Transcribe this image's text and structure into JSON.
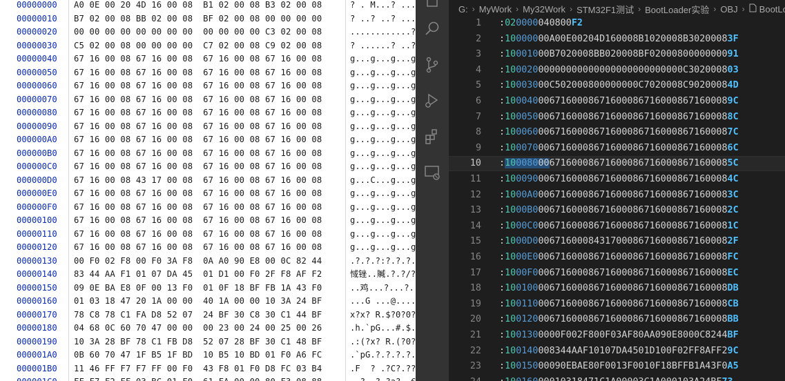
{
  "hex_view": {
    "rows": [
      {
        "addr": "00000000",
        "bytes": "A0 0E 00 20 4D 16 00 08  B1 02 00 08 B3 02 00 08",
        "ascii": "? . M...? ...? ."
      },
      {
        "addr": "00000010",
        "bytes": "B7 02 00 08 BB 02 00 08  BF 02 00 08 00 00 00 00",
        "ascii": "? ..? ..? ......"
      },
      {
        "addr": "00000020",
        "bytes": "00 00 00 00 00 00 00 00  00 00 00 00 C3 02 00 08",
        "ascii": "............? .."
      },
      {
        "addr": "00000030",
        "bytes": "C5 02 00 08 00 00 00 00  C7 02 00 08 C9 02 00 08",
        "ascii": "? ......? ..? .."
      },
      {
        "addr": "00000040",
        "bytes": "67 16 00 08 67 16 00 08  67 16 00 08 67 16 00 08",
        "ascii": "g...g...g...g..."
      },
      {
        "addr": "00000050",
        "bytes": "67 16 00 08 67 16 00 08  67 16 00 08 67 16 00 08",
        "ascii": "g...g...g...g..."
      },
      {
        "addr": "00000060",
        "bytes": "67 16 00 08 67 16 00 08  67 16 00 08 67 16 00 08",
        "ascii": "g...g...g...g..."
      },
      {
        "addr": "00000070",
        "bytes": "67 16 00 08 67 16 00 08  67 16 00 08 67 16 00 08",
        "ascii": "g...g...g...g..."
      },
      {
        "addr": "00000080",
        "bytes": "67 16 00 08 67 16 00 08  67 16 00 08 67 16 00 08",
        "ascii": "g...g...g...g..."
      },
      {
        "addr": "00000090",
        "bytes": "67 16 00 08 67 16 00 08  67 16 00 08 67 16 00 08",
        "ascii": "g...g...g...g..."
      },
      {
        "addr": "000000A0",
        "bytes": "67 16 00 08 67 16 00 08  67 16 00 08 67 16 00 08",
        "ascii": "g...g...g...g..."
      },
      {
        "addr": "000000B0",
        "bytes": "67 16 00 08 67 16 00 08  67 16 00 08 67 16 00 08",
        "ascii": "g...g...g...g..."
      },
      {
        "addr": "000000C0",
        "bytes": "67 16 00 08 67 16 00 08  67 16 00 08 67 16 00 08",
        "ascii": "g...g...g...g..."
      },
      {
        "addr": "000000D0",
        "bytes": "67 16 00 08 43 17 00 08  67 16 00 08 67 16 00 08",
        "ascii": "g...C...g...g..."
      },
      {
        "addr": "000000E0",
        "bytes": "67 16 00 08 67 16 00 08  67 16 00 08 67 16 00 08",
        "ascii": "g...g...g...g..."
      },
      {
        "addr": "000000F0",
        "bytes": "67 16 00 08 67 16 00 08  67 16 00 08 67 16 00 08",
        "ascii": "g...g...g...g..."
      },
      {
        "addr": "00000100",
        "bytes": "67 16 00 08 67 16 00 08  67 16 00 08 67 16 00 08",
        "ascii": "g...g...g...g..."
      },
      {
        "addr": "00000110",
        "bytes": "67 16 00 08 67 16 00 08  67 16 00 08 67 16 00 08",
        "ascii": "g...g...g...g..."
      },
      {
        "addr": "00000120",
        "bytes": "67 16 00 08 67 16 00 08  67 16 00 08 67 16 00 08",
        "ascii": "g...g...g...g..."
      },
      {
        "addr": "00000130",
        "bytes": "00 F0 02 F8 00 F0 3A F8  0A A0 90 E8 00 0C 82 44",
        "ascii": ".?.?.?:?.?.?..?D"
      },
      {
        "addr": "00000140",
        "bytes": "83 44 AA F1 01 07 DA 45  01 D1 00 F0 2F F8 AF F2",
        "ascii": "惐锉..贓.?.?/?"
      },
      {
        "addr": "00000150",
        "bytes": "09 0E BA E8 0F 00 13 F0  01 0F 18 BF FB 1A 43 F0",
        "ascii": "..鸡...?...?..C?"
      },
      {
        "addr": "00000160",
        "bytes": "01 03 18 47 20 1A 00 00  40 1A 00 00 10 3A 24 BF",
        "ascii": "...G ...@....:$?"
      },
      {
        "addr": "00000170",
        "bytes": "78 C8 78 C1 FA D8 52 07  24 BF 30 C8 30 C1 44 BF",
        "ascii": "x?x? R.$?0?0?D?"
      },
      {
        "addr": "00000180",
        "bytes": "04 68 0C 60 70 47 00 00  00 23 00 24 00 25 00 26",
        "ascii": ".h.`pG...#.$.%.&"
      },
      {
        "addr": "00000190",
        "bytes": "10 3A 28 BF 78 C1 FB D8  52 07 28 BF 30 C1 48 BF",
        "ascii": ".:(?x? R.(?0?H?"
      },
      {
        "addr": "000001A0",
        "bytes": "0B 60 70 47 1F B5 1F BD  10 B5 10 BD 01 F0 A6 FC",
        "ascii": ".`pG.?.?.?.?.?"
      },
      {
        "addr": "000001B0",
        "bytes": "11 46 FF F7 F7 FF 00 F0  43 F8 01 F0 D8 FC 03 B4",
        "ascii": ".F  ? .?C?.??.?"
      },
      {
        "addr": "000001C0",
        "bytes": "FF F7 F2 FF 03 BC 01 F0  61 FA 00 00 80 F3 08 88",
        "ascii": "  ? .?.?a?..€?.?"
      }
    ]
  },
  "activity_bar": {
    "badge": "1",
    "items": [
      "explorer-icon",
      "search-icon",
      "source-control-icon",
      "run-debug-icon",
      "extensions-icon",
      "remote-explorer-icon"
    ]
  },
  "breadcrumb": [
    "G:",
    "MyWork",
    "My32Work",
    "STM32F1测试",
    "BootLoader实验",
    "OBJ",
    "BootLoa"
  ],
  "editor": {
    "current_line": 10,
    "lines": [
      {
        "n": "1",
        "len": "02",
        "addr": "0000",
        "type": "04",
        "data": "0800",
        "sum": "F2"
      },
      {
        "n": "2",
        "len": "10",
        "addr": "0000",
        "type": "00",
        "data": "A00E00204D160008B1020008B3020008",
        "sum": "3F"
      },
      {
        "n": "3",
        "len": "10",
        "addr": "0010",
        "type": "00",
        "data": "B7020008BB020008BF02000800000000",
        "sum": "91"
      },
      {
        "n": "4",
        "len": "10",
        "addr": "0020",
        "type": "00",
        "data": "000000000000000000000000C3020008",
        "sum": "03"
      },
      {
        "n": "5",
        "len": "10",
        "addr": "0030",
        "type": "00",
        "data": "C502000800000000C7020008C9020008",
        "sum": "4D"
      },
      {
        "n": "6",
        "len": "10",
        "addr": "0040",
        "type": "00",
        "data": "67160008671600086716000867160008",
        "sum": "9C"
      },
      {
        "n": "7",
        "len": "10",
        "addr": "0050",
        "type": "00",
        "data": "67160008671600086716000867160008",
        "sum": "8C"
      },
      {
        "n": "8",
        "len": "10",
        "addr": "0060",
        "type": "00",
        "data": "67160008671600086716000867160008",
        "sum": "7C"
      },
      {
        "n": "9",
        "len": "10",
        "addr": "0070",
        "type": "00",
        "data": "67160008671600086716000867160008",
        "sum": "6C"
      },
      {
        "n": "10",
        "len": "10",
        "addr": "0080",
        "type": "00",
        "data": "67160008671600086716000867160008",
        "sum": "5C"
      },
      {
        "n": "11",
        "len": "10",
        "addr": "0090",
        "type": "00",
        "data": "67160008671600086716000867160008",
        "sum": "4C"
      },
      {
        "n": "12",
        "len": "10",
        "addr": "00A0",
        "type": "00",
        "data": "67160008671600086716000867160008",
        "sum": "3C"
      },
      {
        "n": "13",
        "len": "10",
        "addr": "00B0",
        "type": "00",
        "data": "67160008671600086716000867160008",
        "sum": "2C"
      },
      {
        "n": "14",
        "len": "10",
        "addr": "00C0",
        "type": "00",
        "data": "67160008671600086716000867160008",
        "sum": "1C"
      },
      {
        "n": "15",
        "len": "10",
        "addr": "00D0",
        "type": "00",
        "data": "67160008431700086716000867160008",
        "sum": "2F"
      },
      {
        "n": "16",
        "len": "10",
        "addr": "00E0",
        "type": "00",
        "data": "67160008671600086716000867160008",
        "sum": "FC"
      },
      {
        "n": "17",
        "len": "10",
        "addr": "00F0",
        "type": "00",
        "data": "67160008671600086716000867160008",
        "sum": "EC"
      },
      {
        "n": "18",
        "len": "10",
        "addr": "0100",
        "type": "00",
        "data": "67160008671600086716000867160008",
        "sum": "DB"
      },
      {
        "n": "19",
        "len": "10",
        "addr": "0110",
        "type": "00",
        "data": "67160008671600086716000867160008",
        "sum": "CB"
      },
      {
        "n": "20",
        "len": "10",
        "addr": "0120",
        "type": "00",
        "data": "67160008671600086716000867160008",
        "sum": "BB"
      },
      {
        "n": "21",
        "len": "10",
        "addr": "0130",
        "type": "00",
        "data": "00F002F800F03AF80AA090E8000C8244",
        "sum": "BF"
      },
      {
        "n": "22",
        "len": "10",
        "addr": "0140",
        "type": "00",
        "data": "8344AAF10107DA4501D100F02FF8AFF2",
        "sum": "9C"
      },
      {
        "n": "23",
        "len": "10",
        "addr": "0150",
        "type": "00",
        "data": "090EBAE80F0013F0010F18BFFB1A43F0",
        "sum": "A5"
      },
      {
        "n": "24",
        "len": "10",
        "addr": "0160",
        "type": "00",
        "data": "010318471C1A00003C1A000103A24BF",
        "sum": "73"
      }
    ]
  }
}
